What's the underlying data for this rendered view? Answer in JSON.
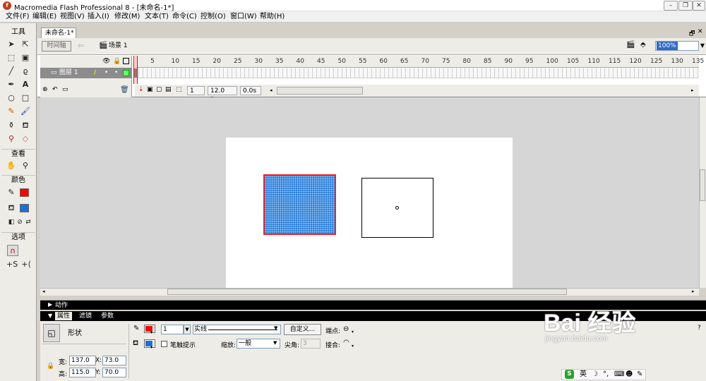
{
  "window": {
    "title": "Macromedia Flash Professional 8 - [未命名-1*]",
    "app_icon": "flash-icon",
    "buttons": [
      "minimize",
      "restore",
      "close"
    ]
  },
  "menu": [
    "文件(F)",
    "编辑(E)",
    "视图(V)",
    "插入(I)",
    "修改(M)",
    "文本(T)",
    "命令(C)",
    "控制(O)",
    "窗口(W)",
    "帮助(H)"
  ],
  "toolbox": {
    "sections": {
      "tools": "工具",
      "view": "查看",
      "colors": "颜色",
      "options": "选项"
    }
  },
  "document": {
    "tab": "未命名-1*"
  },
  "editbar": {
    "timeline_button": "时间轴",
    "scene": "场景 1",
    "zoom": "100%"
  },
  "timeline": {
    "frame_numbers": [
      "5",
      "10",
      "15",
      "20",
      "25",
      "30",
      "35",
      "40",
      "45",
      "50",
      "55",
      "60",
      "65",
      "70",
      "75",
      "80",
      "85",
      "90",
      "95",
      "100",
      "105",
      "110",
      "115",
      "120",
      "125",
      "130",
      "135"
    ],
    "layer": {
      "name": "图层 1"
    },
    "current_frame": "1",
    "fps": "12.0 fps",
    "time": "0.0s"
  },
  "panels": {
    "actions": "动作",
    "tabs": [
      "属性",
      "滤镜",
      "参数"
    ]
  },
  "properties": {
    "type_label": "形状",
    "stroke_height": "1",
    "stroke_style": "实线",
    "custom_button": "自定义...",
    "cap_label": "端点:",
    "hinting_label": "笔触提示",
    "scale_label": "缩放:",
    "scale_value": "一般",
    "miter_label": "尖角:",
    "miter_value": "3",
    "join_label": "接合:",
    "w_label": "宽:",
    "w": "137.0",
    "x_label": "X:",
    "x": "73.0",
    "h_label": "高:",
    "h": "115.0",
    "y_label": "Y:",
    "y": "70.0"
  },
  "colors": {
    "stroke": "#ff0000",
    "fill": "#1f6fd1",
    "shape_fill": "#2e7fd8",
    "shape_border": "#e8262f",
    "accent": "#316ac5"
  },
  "watermark": {
    "text": "Bai 经验",
    "url": "jingyan.baidu.com"
  },
  "ime": {
    "label": "英"
  }
}
